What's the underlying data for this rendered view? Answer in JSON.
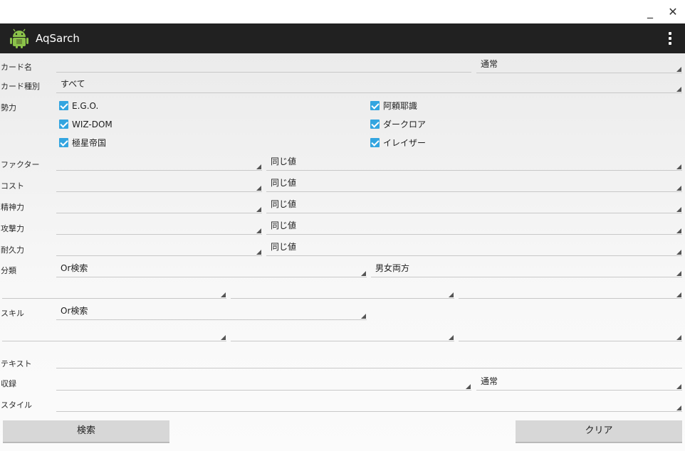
{
  "window": {
    "minimize_label": "_",
    "close_label": "✕"
  },
  "app": {
    "title": "AqSarch",
    "icon": "android-icon",
    "menu_icon": "overflow-menu-icon"
  },
  "form": {
    "card_name": {
      "label": "カード名",
      "value": "",
      "mode": "通常"
    },
    "card_type": {
      "label": "カード種別",
      "value": "すべて"
    },
    "faction": {
      "label": "勢力",
      "options": [
        {
          "label": "E.G.O.",
          "checked": true
        },
        {
          "label": "阿頼耶識",
          "checked": true
        },
        {
          "label": "WIZ-DOM",
          "checked": true
        },
        {
          "label": "ダークロア",
          "checked": true
        },
        {
          "label": "極星帝国",
          "checked": true
        },
        {
          "label": "イレイザー",
          "checked": true
        }
      ]
    },
    "factor": {
      "label": "ファクター",
      "value": "",
      "compare": "同じ値"
    },
    "cost": {
      "label": "コスト",
      "value": "",
      "compare": "同じ値"
    },
    "spirit": {
      "label": "精神力",
      "value": "",
      "compare": "同じ値"
    },
    "attack": {
      "label": "攻撃力",
      "value": "",
      "compare": "同じ値"
    },
    "defense": {
      "label": "耐久力",
      "value": "",
      "compare": "同じ値"
    },
    "category": {
      "label": "分類",
      "mode": "Or検索",
      "gender": "男女両方"
    },
    "skill": {
      "label": "スキル",
      "mode": "Or検索"
    },
    "text": {
      "label": "テキスト",
      "value": ""
    },
    "recorded": {
      "label": "収録",
      "value": "",
      "mode": "通常"
    },
    "style": {
      "label": "スタイル",
      "value": ""
    }
  },
  "buttons": {
    "search": "検索",
    "clear": "クリア"
  },
  "colors": {
    "appbar": "#212121",
    "checkbox": "#33a5e0"
  }
}
